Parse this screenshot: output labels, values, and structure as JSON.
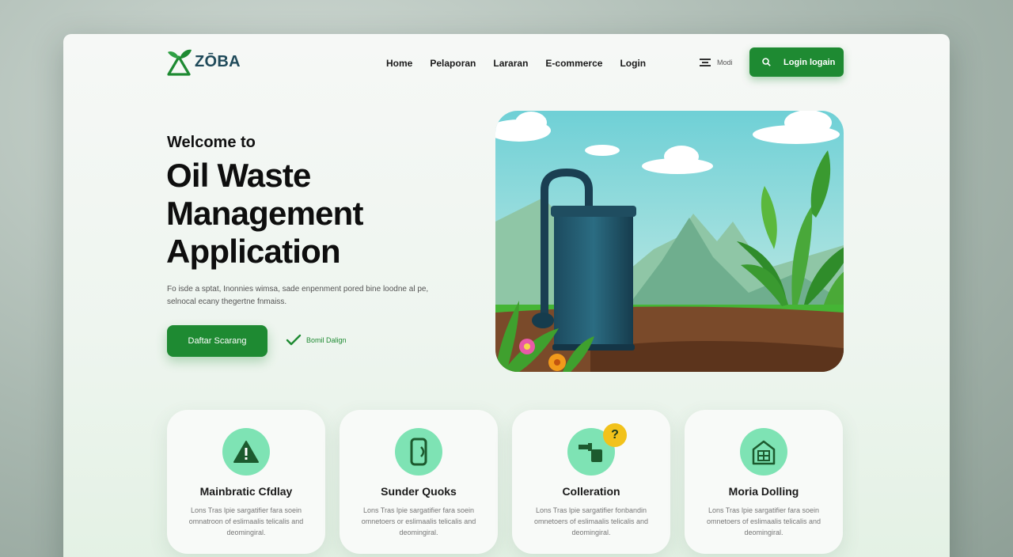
{
  "brand": {
    "name": "ZŌBA"
  },
  "nav": {
    "items": [
      "Home",
      "Pelaporan",
      "Lararan",
      "E-commerce",
      "Login"
    ]
  },
  "lang": {
    "label": "Modi"
  },
  "header": {
    "login_label": "Login logain"
  },
  "hero": {
    "welcome": "Welcome to",
    "title_lines": [
      "Oil Waste",
      "Management",
      "Application"
    ],
    "description": "Fo isde a sptat, Inonnies wimsa, sade enpenment pored bine loodne al pe, selnocal ecany thegertne fnmaiss.",
    "cta_label": "Daftar Scarang",
    "secondary_label": "Bomil Dalign"
  },
  "cards": [
    {
      "title": "Mainbratic Cfdlay",
      "description": "Lons Tras lpie sargatifier fara soein omnatroon of eslimaalis telicalis and deomingiral.",
      "icon": "warning-icon"
    },
    {
      "title": "Sunder Quoks",
      "description": "Lons Tras lpie sargatifier fara soein omnetoers or eslimaalis telicalis and deomingiral.",
      "icon": "phone-icon"
    },
    {
      "title": "Colleration",
      "description": "Lons Tras lpie sargatifier fonbandin omnetoers of eslimaalis telicalis and deomingiral.",
      "icon": "pipe-icon",
      "badge": "?"
    },
    {
      "title": "Moria Dolling",
      "description": "Lons Tras lpie sargatifier fara soein omnetoers of eslimaalis telicalis and deomingiral.",
      "icon": "house-icon"
    }
  ],
  "colors": {
    "primary": "#1e8a32",
    "mint": "#7ee3b4",
    "accent": "#f2c21b"
  }
}
